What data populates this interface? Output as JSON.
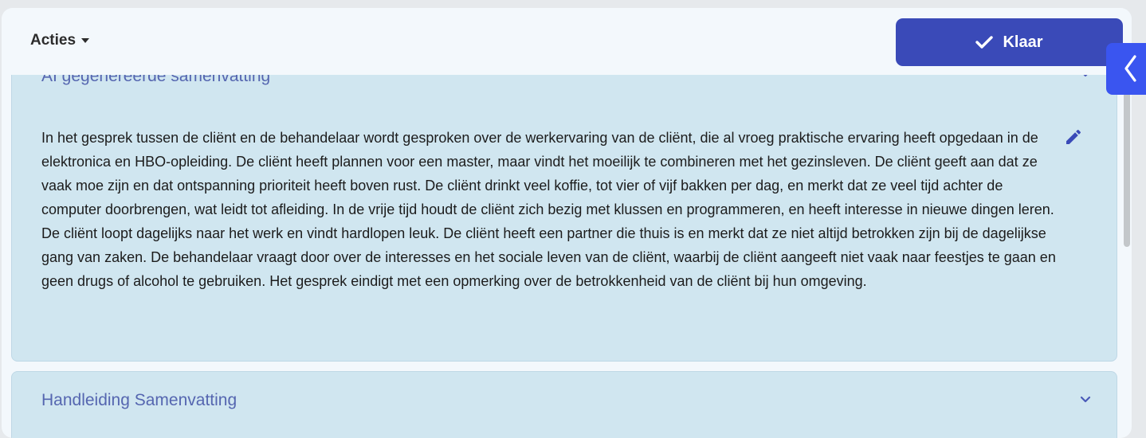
{
  "toolbar": {
    "actions_label": "Acties",
    "done_label": "Klaar"
  },
  "ai_summary": {
    "title": "AI gegenereerde samenvatting",
    "text": "In het gesprek tussen de cliënt en de behandelaar wordt gesproken over de werkervaring van de cliënt, die al vroeg praktische ervaring heeft opgedaan in de elektronica en HBO-opleiding. De cliënt heeft plannen voor een master, maar vindt het moeilijk te combineren met het gezinsleven. De cliënt geeft aan dat ze vaak moe zijn en dat ontspanning prioriteit heeft boven rust. De cliënt drinkt veel koffie, tot vier of vijf bakken per dag, en merkt dat ze veel tijd achter de computer doorbrengen, wat leidt tot afleiding. In de vrije tijd houdt de cliënt zich bezig met klussen en programmeren, en heeft interesse in nieuwe dingen leren. De cliënt loopt dagelijks naar het werk en vindt hardlopen leuk. De cliënt heeft een partner die thuis is en merkt dat ze niet altijd betrokken zijn bij de dagelijkse gang van zaken. De behandelaar vraagt door over de interesses en het sociale leven van de cliënt, waarbij de cliënt aangeeft niet vaak naar feestjes te gaan en geen drugs of alcohol te gebruiken. Het gesprek eindigt met een opmerking over de betrokkenheid van de cliënt bij hun omgeving."
  },
  "manual_summary": {
    "title": "Handleiding Samenvatting"
  },
  "icons": {
    "done": "check-icon",
    "edit": "pencil-icon",
    "collapse": "chevron-down-icon",
    "side_panel": "chevron-left-icon"
  },
  "colors": {
    "accent": "#3a4ab8",
    "side_tab": "#3a55f0",
    "card_bg": "#d0e6f0",
    "card_title": "#5566b0"
  }
}
